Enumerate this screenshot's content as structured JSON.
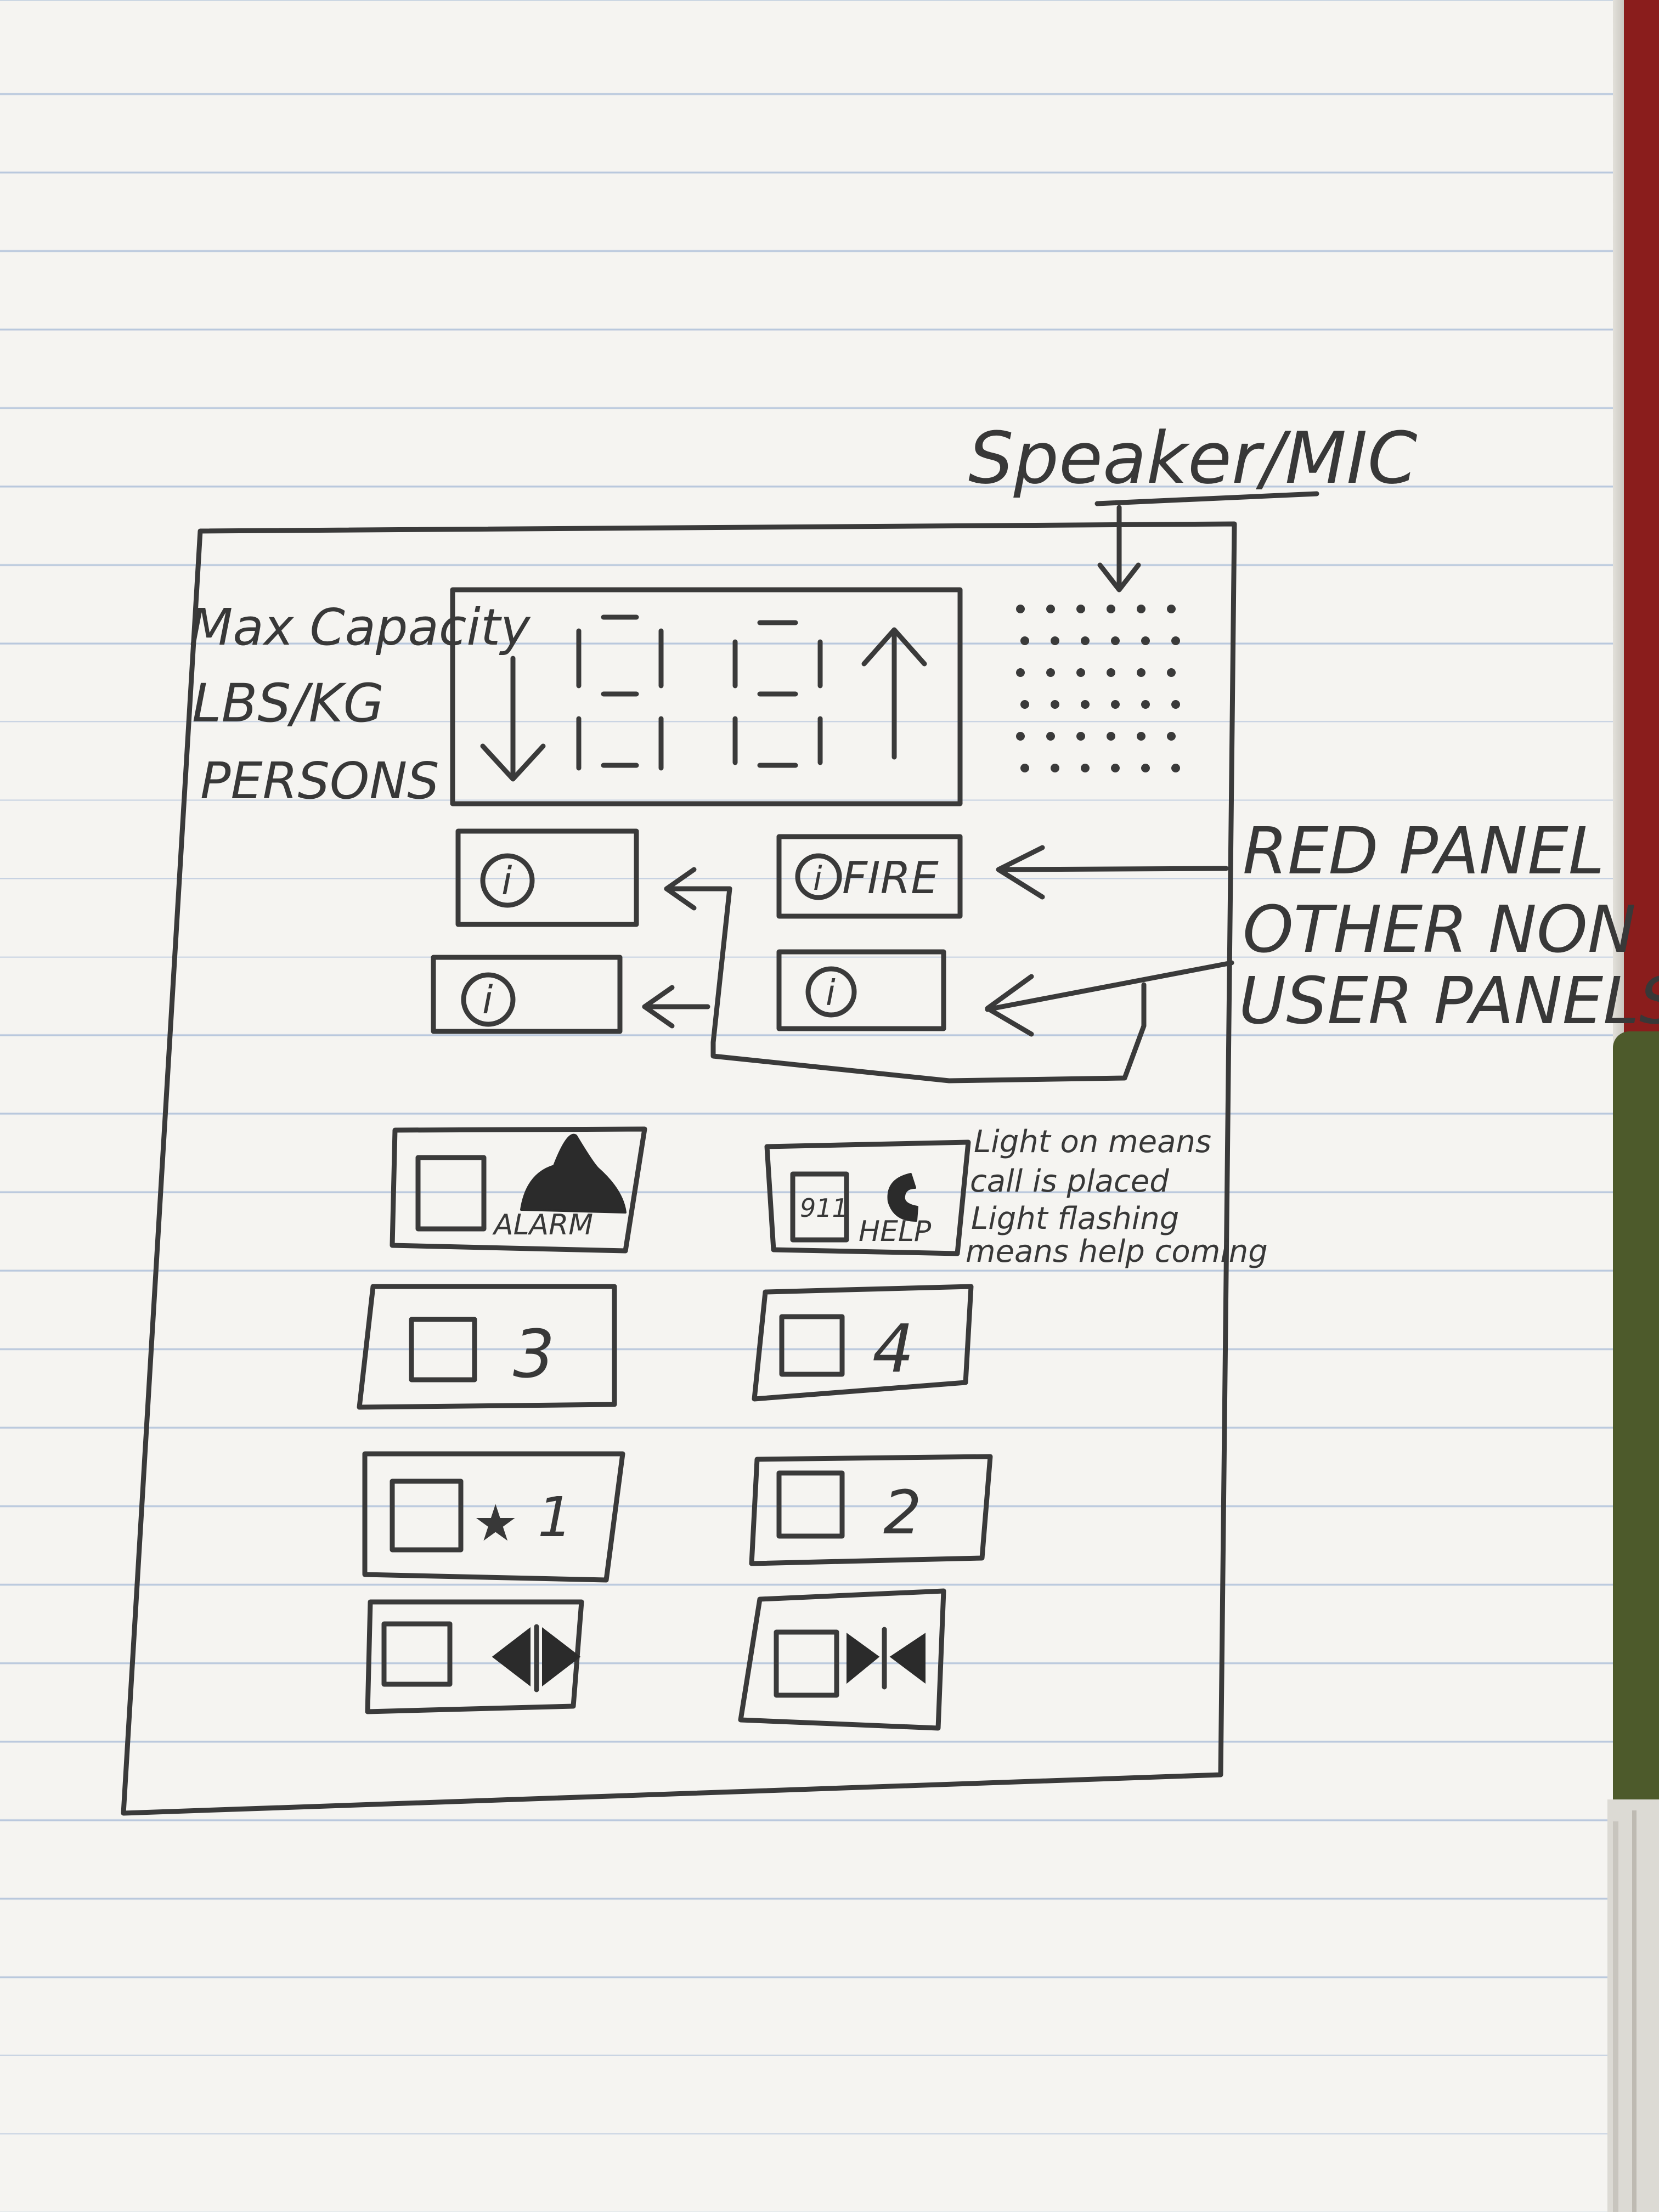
{
  "labels": {
    "speaker_mic": "Speaker/MIC",
    "max_capacity": "Max Capacity",
    "lbs_kg": "LBS/KG",
    "persons": "PERSONS",
    "red_panel": "RED PANEL",
    "other_non_user_panels_line1": "OTHER NON",
    "other_non_user_panels_line2": "USER PANELS"
  },
  "panels": {
    "fire_label": "FIRE",
    "info_symbol": "i"
  },
  "buttons": {
    "alarm_label": "ALARM",
    "help_label": "HELP",
    "help_code": "911",
    "floor_3": "3",
    "floor_4": "4",
    "floor_1": "1",
    "floor_2": "2",
    "star_symbol": "★"
  },
  "note": {
    "line1": "Light on means",
    "line2": "call is placed",
    "line3": "Light flashing",
    "line4": "means help coming"
  },
  "colors": {
    "paper": "#f5f4f1",
    "ruled_line": "#b9c8dd",
    "pencil": "#3a3a3a"
  }
}
